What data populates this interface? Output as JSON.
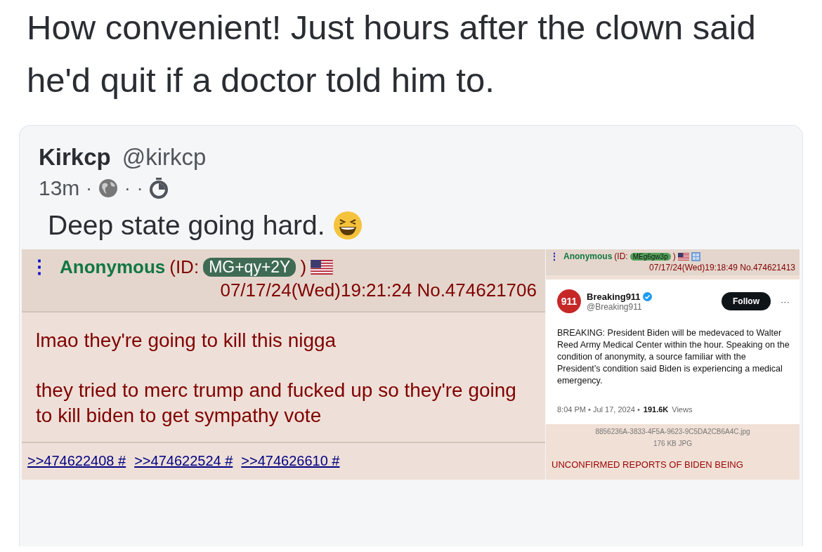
{
  "post": {
    "text": "How convenient! Just hours after the clown said he'd quit if a doctor told him to."
  },
  "quoted_post": {
    "display_name": "Kirkcp",
    "handle": "@kirkcp",
    "meta": [
      {
        "kind": "text",
        "text": "13m"
      },
      {
        "kind": "dot",
        "text": "·"
      },
      {
        "kind": "globe"
      },
      {
        "kind": "dot",
        "text": "·"
      },
      {
        "kind": "dot",
        "text": "·"
      },
      {
        "kind": "timer"
      }
    ],
    "text": "Deep state going hard.",
    "images": [
      {
        "kind": "chan_post",
        "menu": "⋮",
        "name": "Anonymous",
        "id_open": "(ID:",
        "id": "MG+qy+2Y",
        "id_close": ")",
        "timestamp": "07/17/24(Wed)19:21:24 No.474621706",
        "body": [
          "lmao they're going to kill this nigga",
          "they tried to merc trump and fucked up so they're going to kill biden to get sympathy vote"
        ],
        "replies": [
          ">>474622408 #",
          ">>474622524 #",
          ">>474626610 #"
        ]
      },
      {
        "kind": "chan_tweet",
        "menu": "⋮",
        "name": "Anonymous",
        "id_open": "(ID:",
        "id": "MEg6gw3p",
        "id_close": ")",
        "timestamp": "07/17/24(Wed)19:18:49 No.474621413",
        "tweet": {
          "logo_text": "911",
          "name": "Breaking911",
          "handle": "@Breaking911",
          "follow": "Follow",
          "more": "···",
          "text": "BREAKING: President Biden will be medevaced to Walter Reed Army Medical Center within the hour. Speaking on the condition of anonymity, a source familiar with the President’s condition said Biden is experiencing a medical emergency.",
          "time": "8:04 PM • Jul 17, 2024 •",
          "views_count": "191.6K",
          "views_label": "Views"
        },
        "file": {
          "name": "8856236A-3833-4F5A-9623-9C5DA2CB6A4C.jpg",
          "size": "176 KB JPG"
        },
        "subject": "UNCONFIRMED REPORTS OF BIDEN BEING"
      }
    ]
  }
}
